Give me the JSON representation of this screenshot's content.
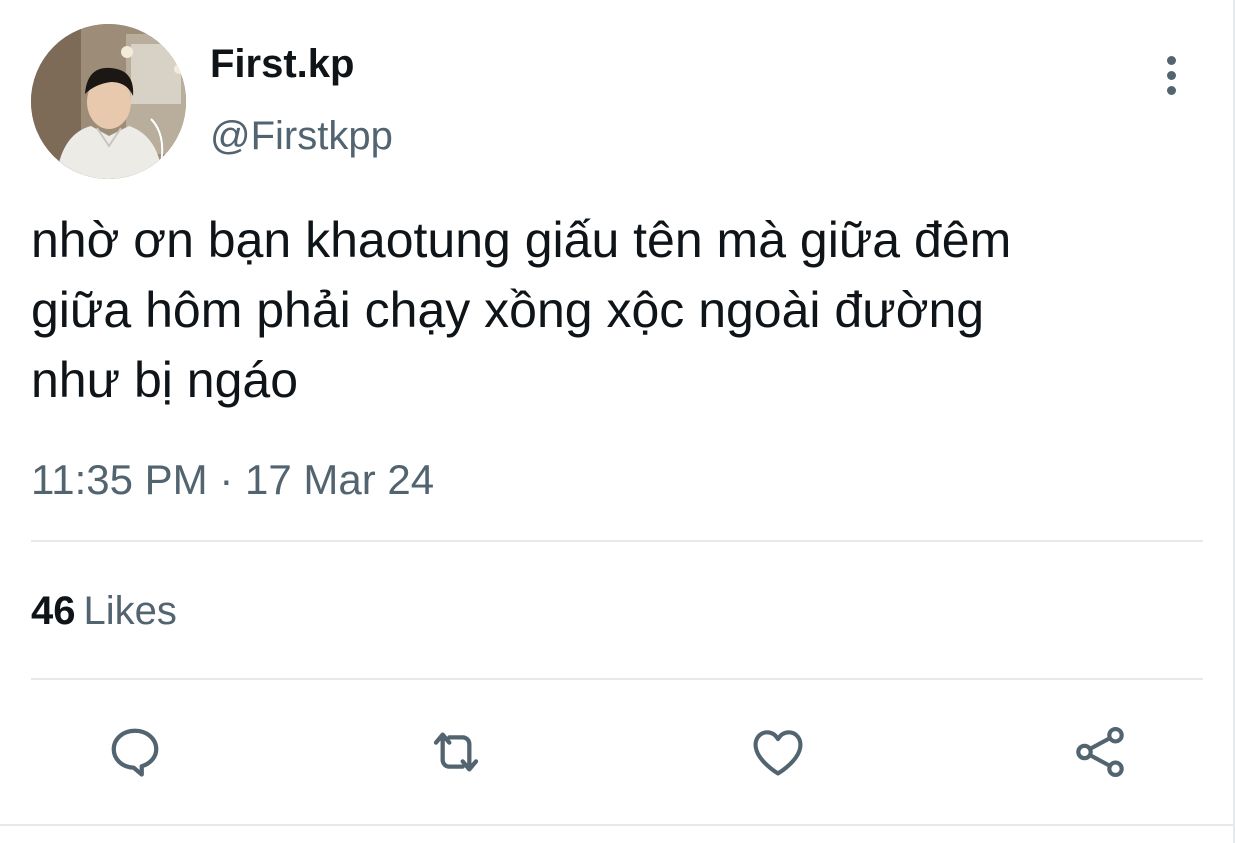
{
  "author": {
    "display_name": "First.kp",
    "handle": "@Firstkpp",
    "avatar_icon": "profile-photo"
  },
  "tweet": {
    "text_lines": [
      "nhờ ơn bạn khaotung giấu tên mà giữa đêm",
      "giữa hôm phải chạy xồng xộc ngoài đường",
      "như bị ngáo"
    ],
    "timestamp": "11:35 PM · 17 Mar 24"
  },
  "stats": {
    "likes_count": "46",
    "likes_label": "Likes"
  },
  "actions": [
    {
      "name": "reply",
      "icon": "speech-bubble-icon"
    },
    {
      "name": "retweet",
      "icon": "retweet-icon"
    },
    {
      "name": "like",
      "icon": "heart-icon"
    },
    {
      "name": "share",
      "icon": "share-icon"
    }
  ],
  "colors": {
    "text_primary": "#0f1419",
    "text_secondary": "#536471",
    "divider": "#e6e9eb",
    "icon": "#536471"
  }
}
